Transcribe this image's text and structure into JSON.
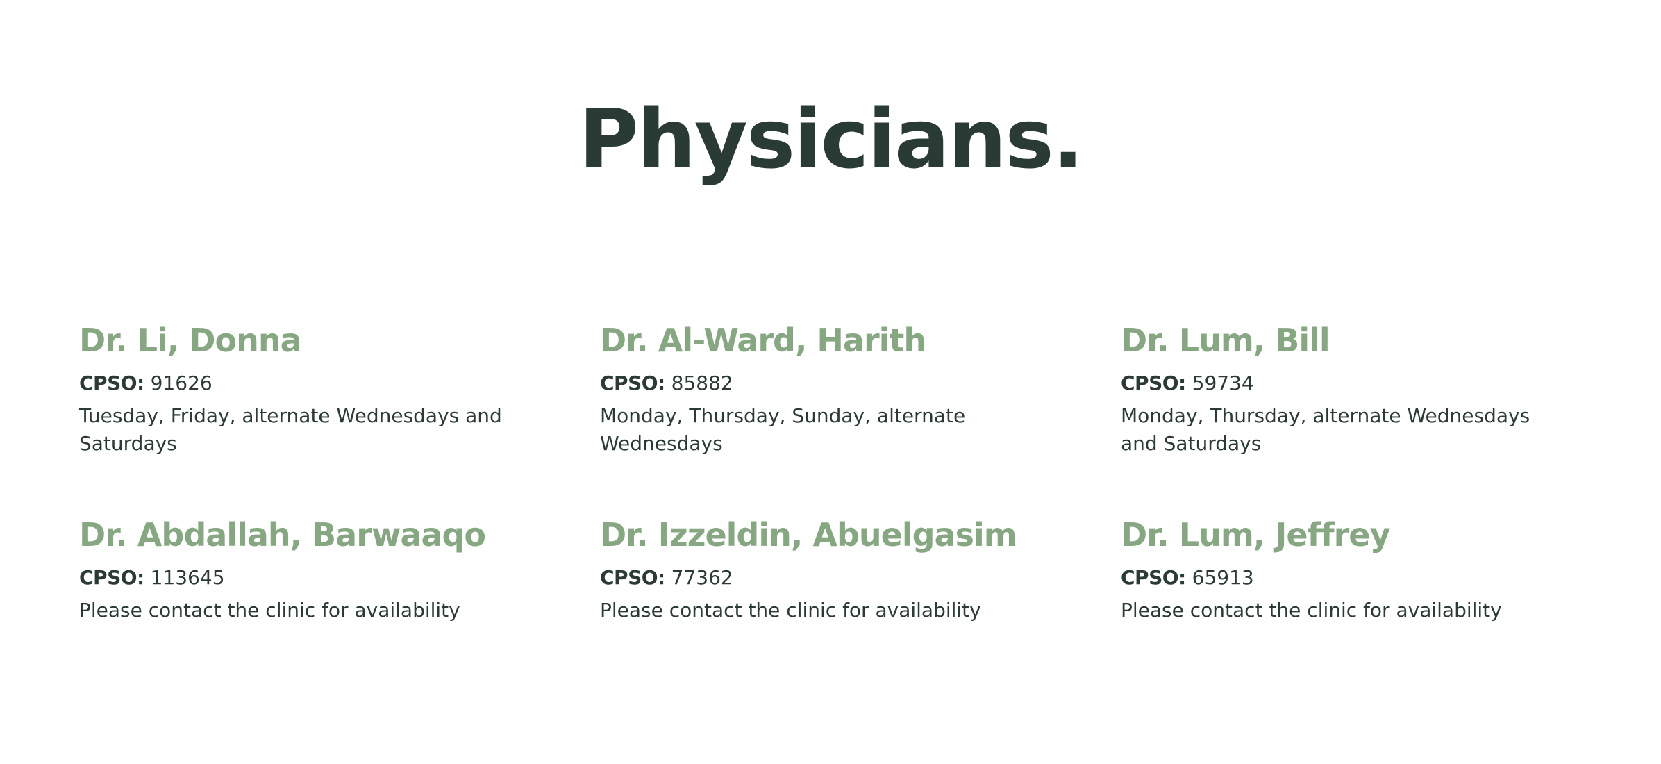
{
  "page": {
    "title": "Physicians."
  },
  "physicians": [
    {
      "name": "Dr. Li, Donna",
      "cpso_label": "CPSO:",
      "cpso_number": "91626",
      "availability": "Tuesday, Friday, alternate Wednesdays and Saturdays"
    },
    {
      "name": "Dr. Al-Ward, Harith",
      "cpso_label": "CPSO:",
      "cpso_number": "85882",
      "availability": "Monday, Thursday, Sunday, alternate Wednesdays"
    },
    {
      "name": "Dr. Lum, Bill",
      "cpso_label": "CPSO:",
      "cpso_number": "59734",
      "availability": "Monday, Thursday, alternate Wednesdays and Saturdays"
    },
    {
      "name": "Dr. Abdallah, Barwaaqo",
      "cpso_label": "CPSO:",
      "cpso_number": "113645",
      "availability": "Please contact the clinic for availability"
    },
    {
      "name": "Dr. Izzeldin, Abuelgasim",
      "cpso_label": "CPSO:",
      "cpso_number": "77362",
      "availability": "Please contact the clinic for availability"
    },
    {
      "name": "Dr. Lum, Jeffrey",
      "cpso_label": "CPSO:",
      "cpso_number": "65913",
      "availability": "Please contact the clinic for availability"
    }
  ],
  "colors": {
    "title": "#2a3b36",
    "name_accent": "#87a783",
    "body_text": "#2b3a35",
    "background": "#ffffff"
  }
}
